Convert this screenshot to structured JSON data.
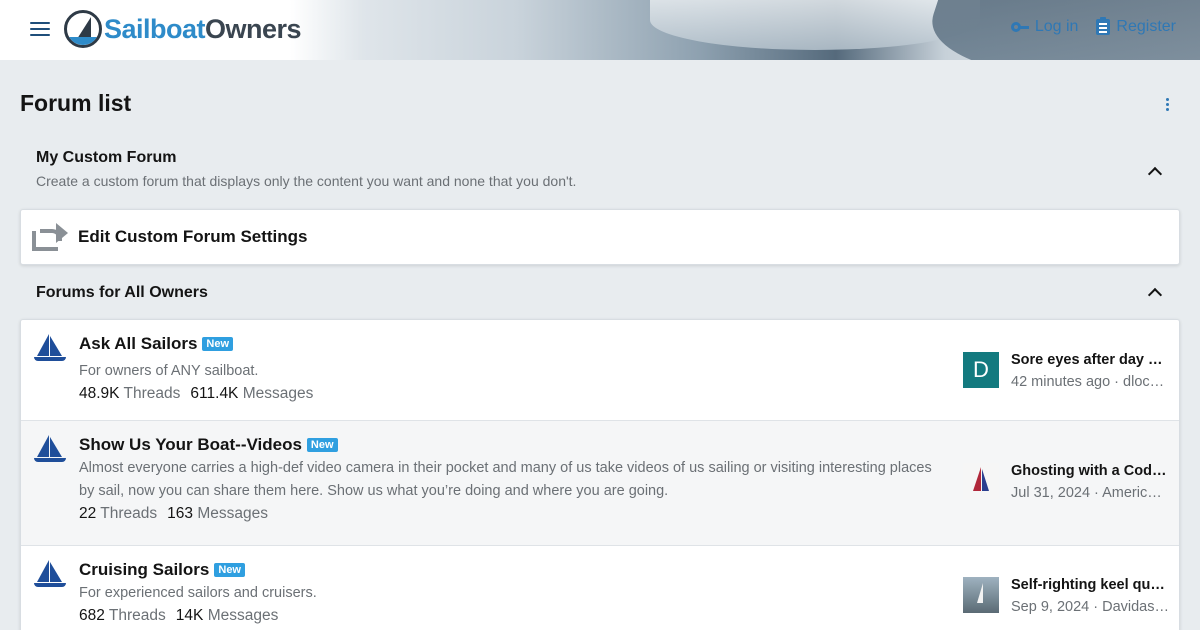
{
  "header": {
    "logo_part1": "Sailboat",
    "logo_part2": "Owners",
    "login_label": "Log in",
    "register_label": "Register"
  },
  "page": {
    "title": "Forum list"
  },
  "custom_forum": {
    "title": "My Custom Forum",
    "description": "Create a custom forum that displays only the content you want and none that you don't.",
    "settings_label": "Edit Custom Forum Settings"
  },
  "category": {
    "title": "Forums for All Owners"
  },
  "forums": [
    {
      "title": "Ask All Sailors",
      "badge": "New",
      "description": "For owners of ANY sailboat.",
      "threads": "48.9K",
      "threads_label": "Threads",
      "messages": "611.4K",
      "messages_label": "Messages",
      "latest_avatar_letter": "D",
      "latest_title": "Sore eyes after day of…",
      "latest_time": "42 minutes ago",
      "latest_user": "dloc…"
    },
    {
      "title": "Show Us Your Boat--Videos",
      "badge": "New",
      "description": "Almost everyone carries a high-def video camera in their pocket and many of us take videos of us sailing or visiting interesting places by sail, now you can share them here. Show us what you’re doing and where you are going.",
      "threads": "22",
      "threads_label": "Threads",
      "messages": "163",
      "messages_label": "Messages",
      "latest_title": "Ghosting with a Code …",
      "latest_time": "Jul 31, 2024",
      "latest_user": "Americ…"
    },
    {
      "title": "Cruising Sailors",
      "badge": "New",
      "description": "For experienced sailors and cruisers.",
      "threads": "682",
      "threads_label": "Threads",
      "messages": "14K",
      "messages_label": "Messages",
      "latest_title": "Self-righting keel que…",
      "latest_time": "Sep 9, 2024",
      "latest_user": "Davidas…"
    }
  ],
  "colors": {
    "accent": "#2f78b5",
    "badge": "#2f9fe0",
    "avatar_d": "#137a7f",
    "page_bg": "#e8ecef"
  }
}
